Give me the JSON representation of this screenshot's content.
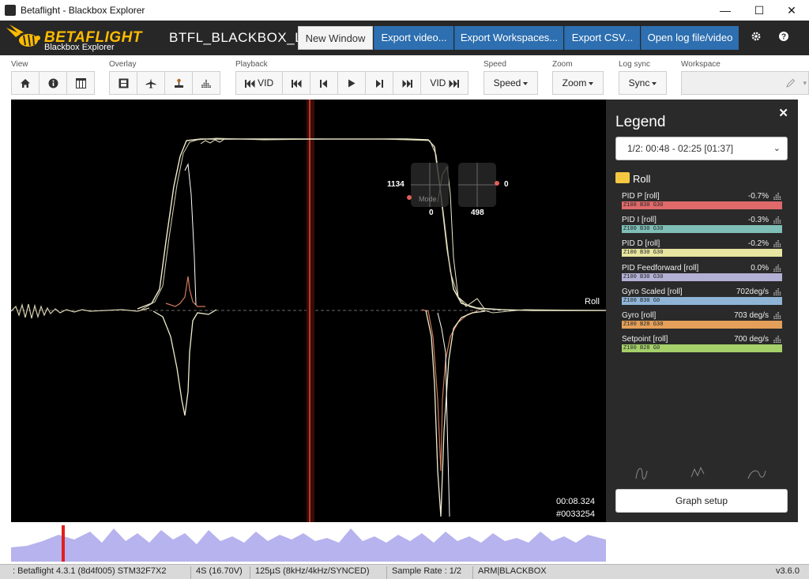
{
  "window": {
    "title": "Betaflight - Blackbox Explorer",
    "minimize": "—",
    "maximize": "☐",
    "close": "✕"
  },
  "header": {
    "logo_title": "BETAFLIGHT",
    "logo_subtitle": "Blackbox Explorer",
    "log_name": "BTFL_BLACKBOX_LOG_",
    "buttons": {
      "new_window": "New Window",
      "export_video": "Export video...",
      "export_workspaces": "Export Workspaces...",
      "export_csv": "Export CSV...",
      "open_log": "Open log file/video"
    }
  },
  "toolbar": {
    "labels": {
      "view": "View",
      "overlay": "Overlay",
      "playback": "Playback",
      "speed": "Speed",
      "zoom": "Zoom",
      "log_sync": "Log sync",
      "workspace": "Workspace"
    },
    "playback": {
      "vid_start": "VID",
      "vid_end": "VID"
    },
    "speed": "Speed",
    "zoom": "Zoom",
    "sync": "Sync",
    "workspace_value": ""
  },
  "graph": {
    "trace_label": "Roll",
    "stick_left_value": "1134",
    "stick_left_label": "Mode",
    "stick_left_bottom": "0",
    "stick_right_value": "0",
    "stick_right_bottom": "498",
    "time": "00:08.324",
    "frame": "#0033254",
    "colors": {
      "background": "#000000",
      "cursor": "#b03020",
      "trace": "#f3f0d8"
    }
  },
  "legend": {
    "title": "Legend",
    "close": "✕",
    "range": "1/2: 00:48 - 02:25 [01:37]",
    "group": "Roll",
    "items": [
      {
        "name": "PID P [roll]",
        "value": "-0.7%",
        "bar_text": "Z100 B30 G30",
        "color": "#e06a6a"
      },
      {
        "name": "PID I [roll]",
        "value": "-0.3%",
        "bar_text": "Z100 B30 G30",
        "color": "#7fbfb8"
      },
      {
        "name": "PID D [roll]",
        "value": "-0.2%",
        "bar_text": "Z100 B30 G30",
        "color": "#e8e6a0"
      },
      {
        "name": "PID Feedforward [roll]",
        "value": "0.0%",
        "bar_text": "Z100 B30 G30",
        "color": "#b3b0d6"
      },
      {
        "name": "Gyro Scaled [roll]",
        "value": "702deg/s",
        "bar_text": "Z100 B30 G0",
        "color": "#8fb4d6"
      },
      {
        "name": "Gyro [roll]",
        "value": "703 deg/s",
        "bar_text": "Z100 B28 G30",
        "color": "#e4a05a"
      },
      {
        "name": "Setpoint [roll]",
        "value": "700 deg/s",
        "bar_text": "Z100 B28 G0",
        "color": "#a5d06a"
      }
    ],
    "graph_setup": "Graph setup"
  },
  "statusbar": {
    "firmware": ": Betaflight 4.3.1 (8d4f005) STM32F7X2",
    "battery": "4S (16.70V)",
    "looptime": "125µS (8kHz/4kHz/SYNCED)",
    "sample_rate": "Sample Rate : 1/2",
    "flags": "ARM|BLACKBOX",
    "version": "v3.6.0"
  }
}
